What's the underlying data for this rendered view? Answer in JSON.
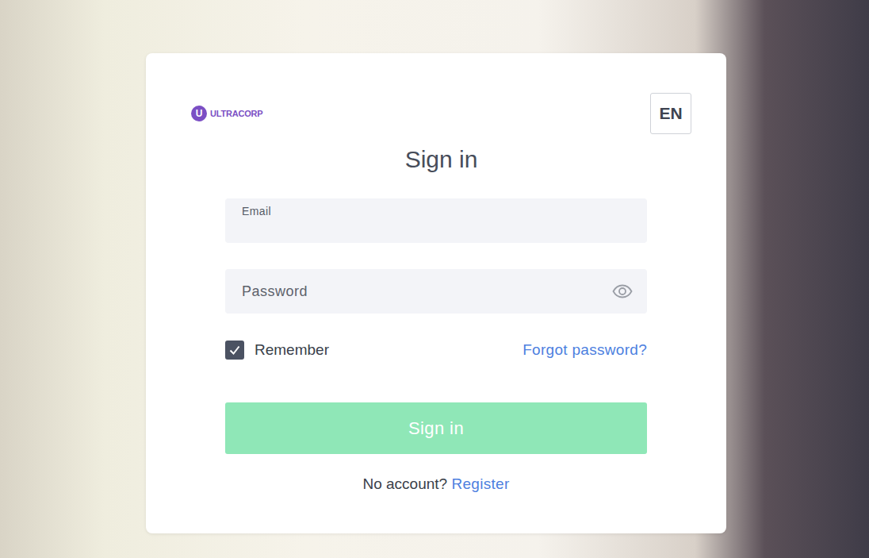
{
  "logo": {
    "mark": "U",
    "name": "ULTRACORP"
  },
  "language": "EN",
  "title": "Sign in",
  "email": {
    "label": "Email"
  },
  "password": {
    "placeholder": "Password"
  },
  "remember": {
    "label": "Remember",
    "checked": true
  },
  "forgot_password": "Forgot password?",
  "submit": {
    "label": "Sign in",
    "disabled": true
  },
  "register": {
    "prompt": "No account?",
    "link": "Register"
  }
}
